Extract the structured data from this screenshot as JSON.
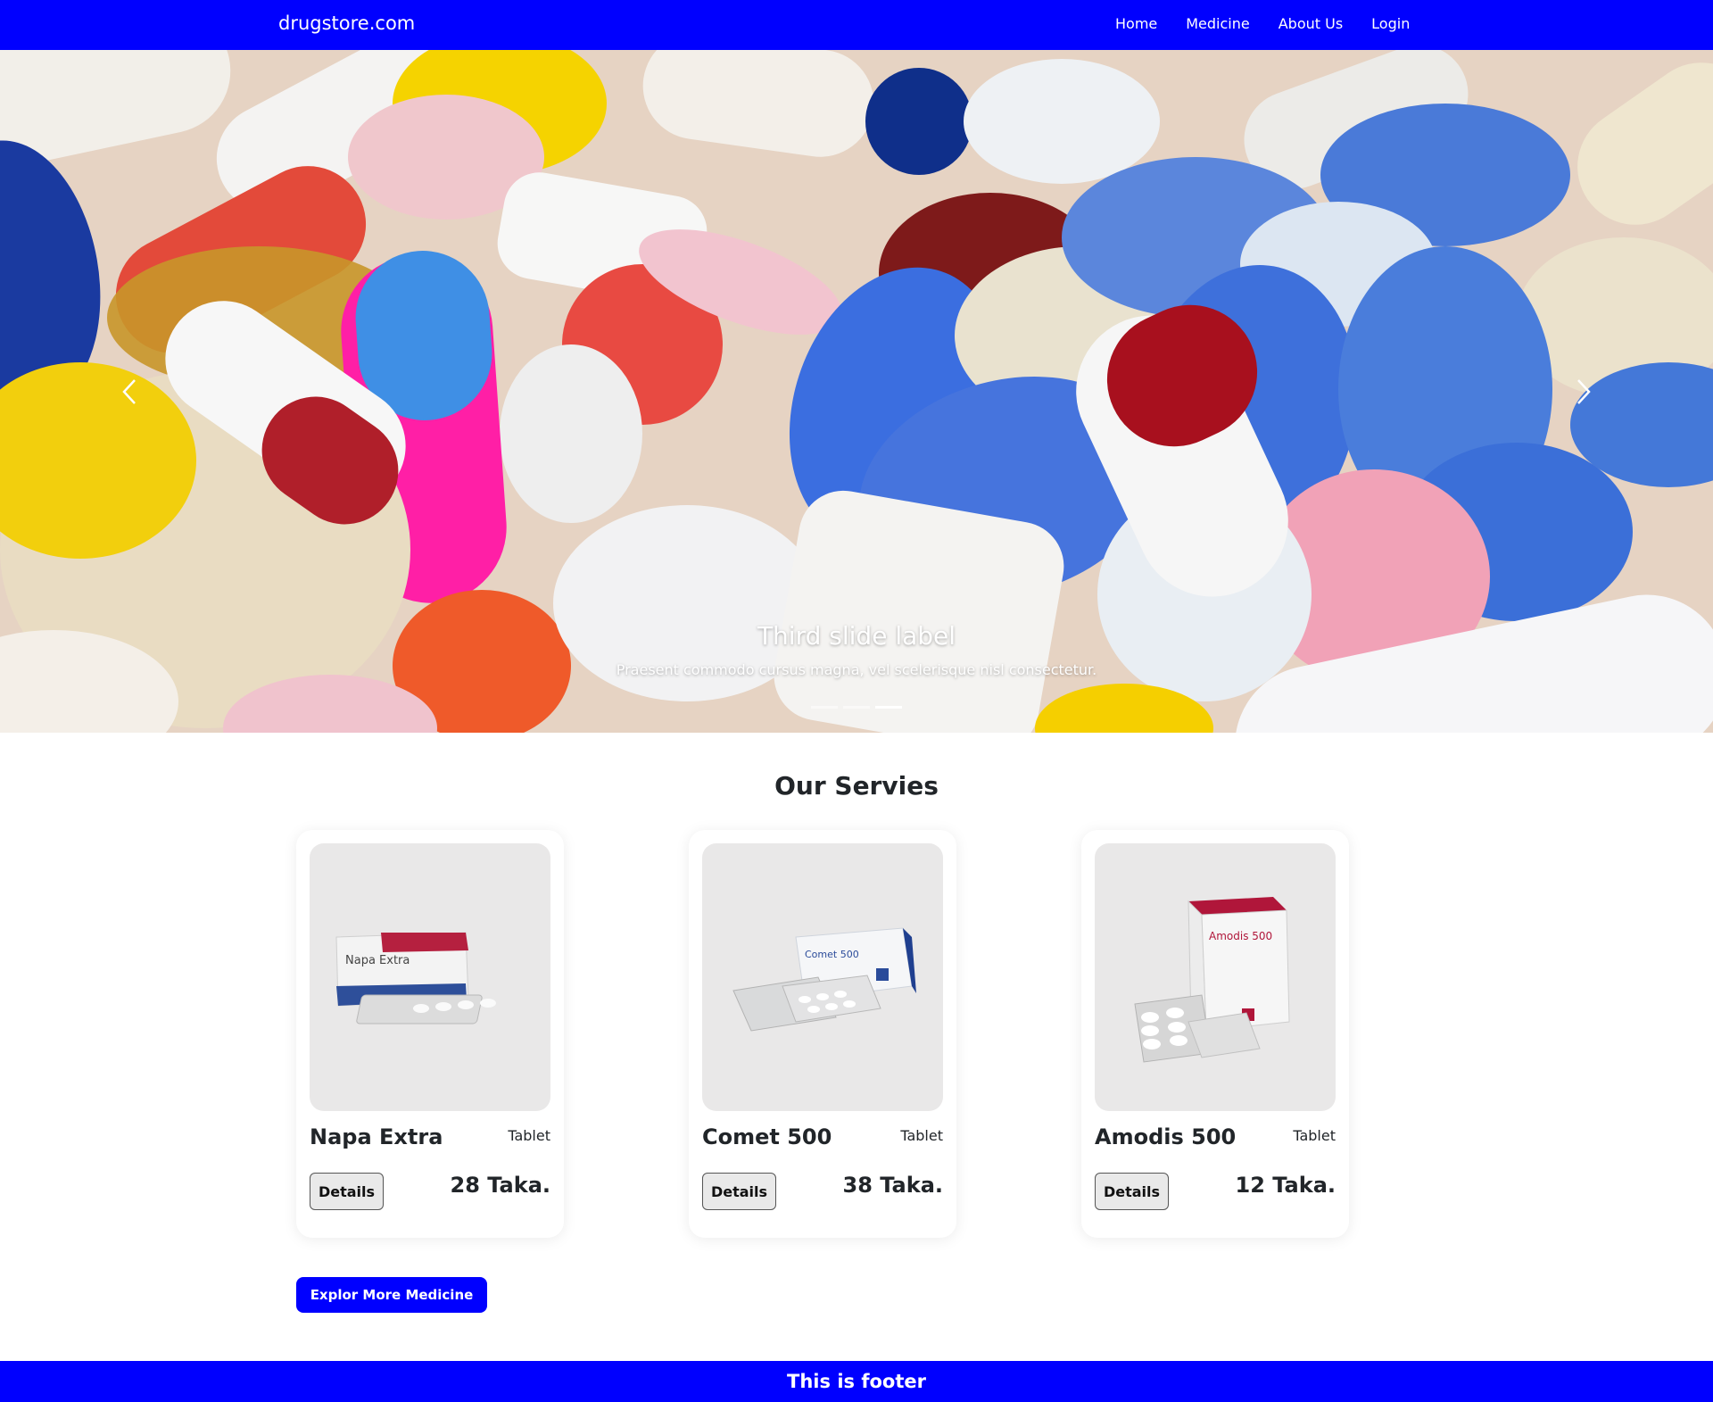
{
  "navbar": {
    "brand": "drugstore.com",
    "links": [
      "Home",
      "Medicine",
      "About Us",
      "Login"
    ]
  },
  "carousel": {
    "caption_title": "Third slide label",
    "caption_text": "Praesent commodo cursus magna, vel scelerisque nisl consectetur.",
    "prev_icon": "chevron-left-icon",
    "next_icon": "chevron-right-icon",
    "slides": 3,
    "active_slide": 3
  },
  "services": {
    "title": "Our Servies",
    "products": [
      {
        "name": "Napa Extra",
        "type": "Tablet",
        "details_label": "Details",
        "price": "28 Taka.",
        "package_text": "Napa Extra"
      },
      {
        "name": "Comet 500",
        "type": "Tablet",
        "details_label": "Details",
        "price": "38 Taka.",
        "package_text": "Comet 500"
      },
      {
        "name": "Amodis 500",
        "type": "Tablet",
        "details_label": "Details",
        "price": "12 Taka.",
        "package_text": "Amodis 500"
      }
    ],
    "explore_label": "Explor More Medicine"
  },
  "footer": {
    "text": "This is footer"
  },
  "colors": {
    "primary": "#0000ff",
    "card_image_bg": "#e9e8e8"
  }
}
